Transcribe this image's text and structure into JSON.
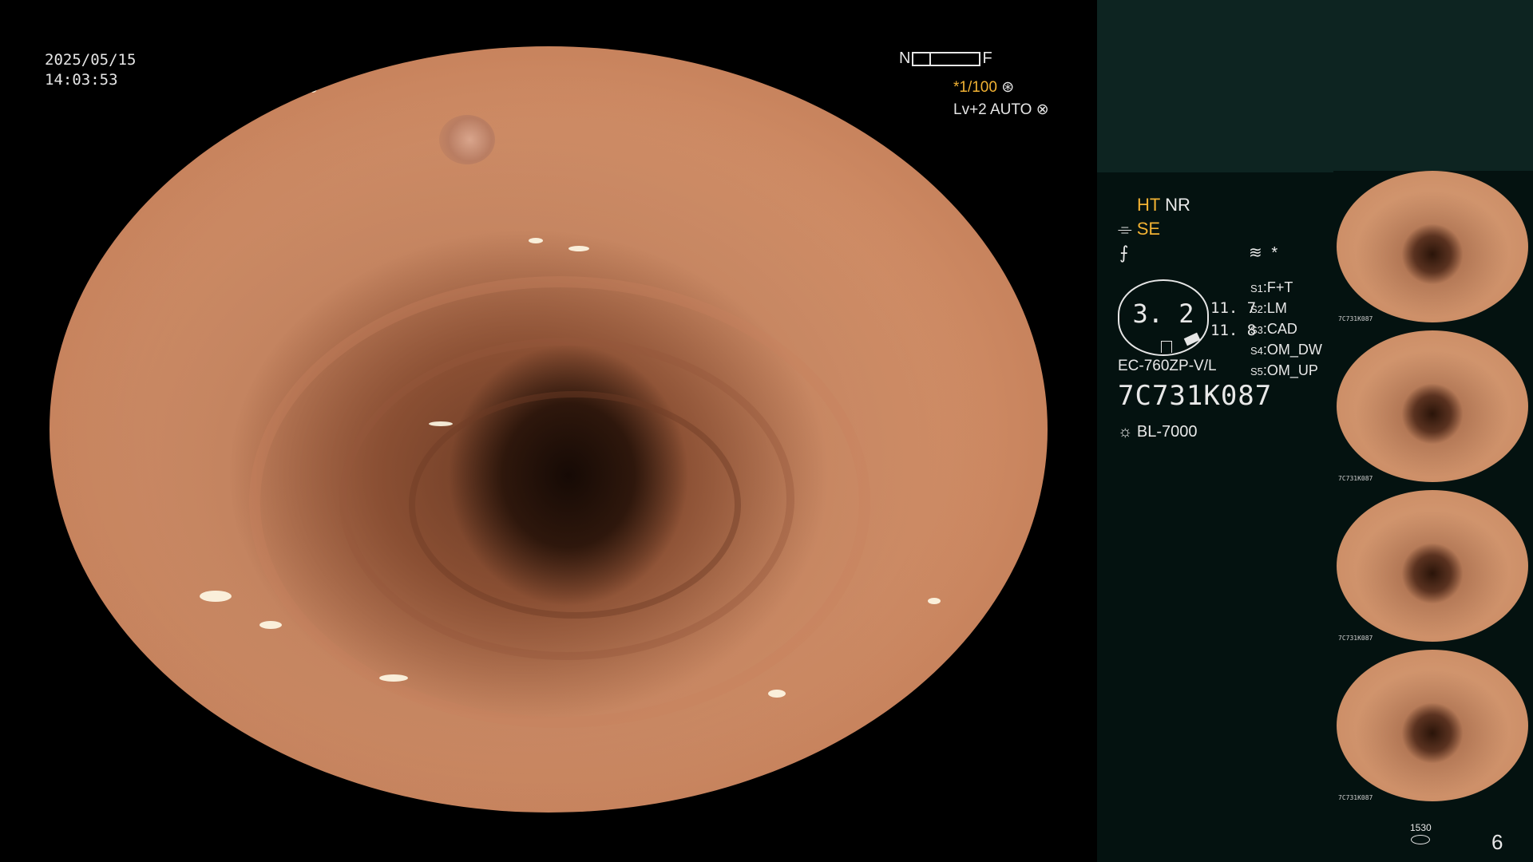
{
  "overlay": {
    "date": "2025/05/15",
    "time": "14:03:53",
    "focus_near": "N",
    "focus_far": "F",
    "shutter": "*1/100",
    "level": "Lv+2",
    "mode": "AUTO"
  },
  "panel": {
    "ht": "HT",
    "nr": "NR",
    "se": "SE",
    "dial_value": "3. 2",
    "val_a": "11. 7",
    "val_b": "11. 8",
    "asterisk": "*",
    "scope_model": "EC-760ZP-V/L",
    "serial": "7C731K087",
    "light_source": "BL-7000",
    "switches": [
      {
        "key": "S1",
        "value": "F+T"
      },
      {
        "key": "S2",
        "value": "LM"
      },
      {
        "key": "S3",
        "value": "CAD"
      },
      {
        "key": "S4",
        "value": "OM_DW"
      },
      {
        "key": "S5",
        "value": "OM_UP"
      }
    ],
    "counter_label": "1530",
    "counter_value": "6"
  },
  "thumbnails": [
    {
      "label": "7C731K087"
    },
    {
      "label": "7C731K087"
    },
    {
      "label": "7C731K087"
    },
    {
      "label": "7C731K087"
    }
  ],
  "colors": {
    "accent_yellow": "#f2b233",
    "panel_bg": "#041210",
    "panel_top_bg": "#0d2421"
  }
}
